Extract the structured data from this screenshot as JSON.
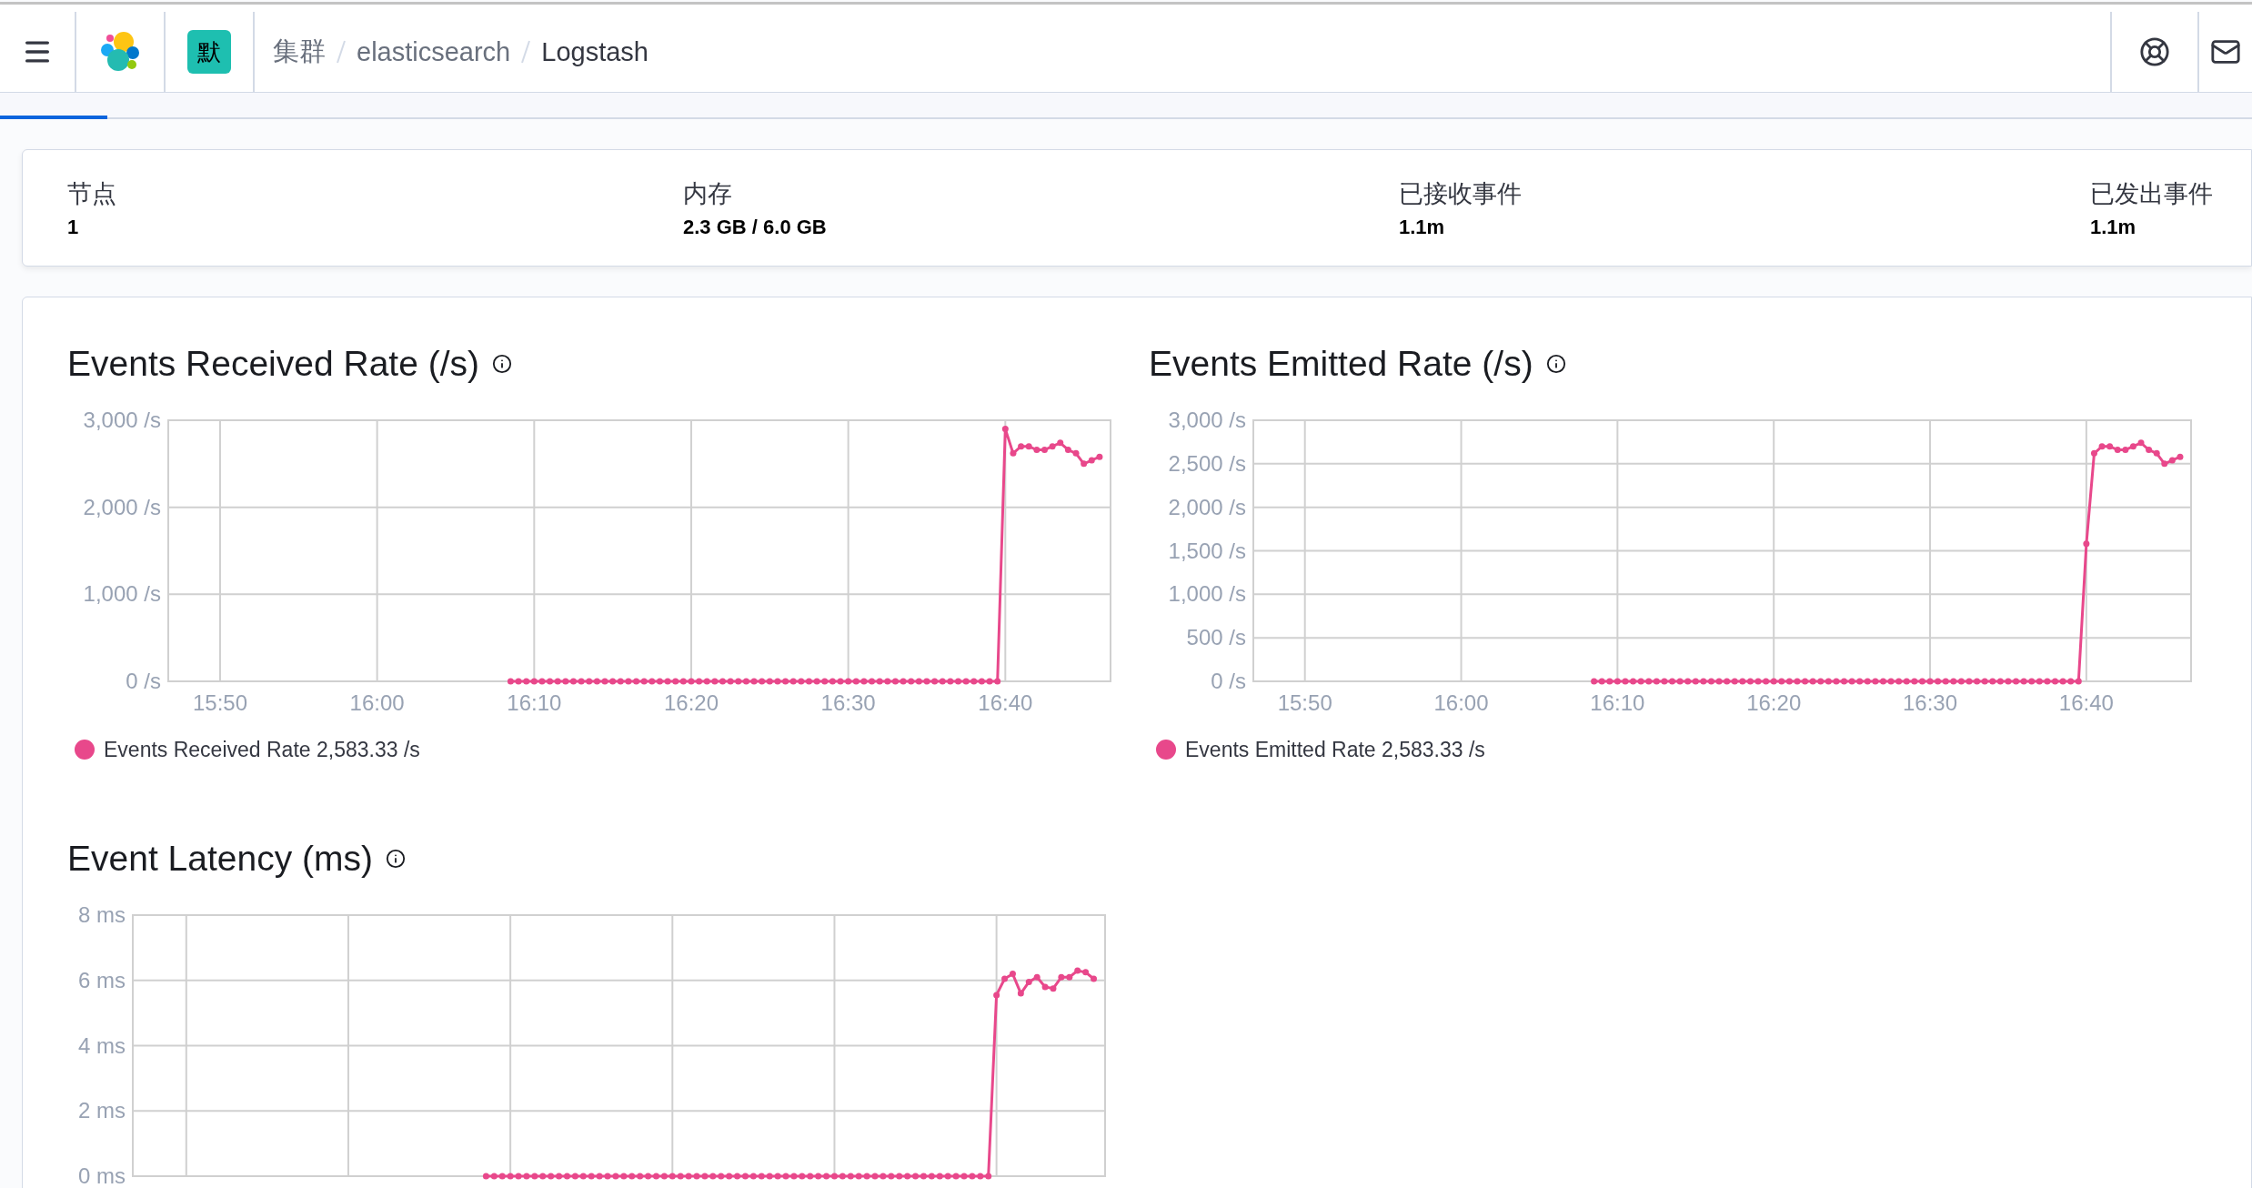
{
  "header": {
    "space_badge": "默",
    "breadcrumbs": [
      {
        "label": "集群",
        "current": false
      },
      {
        "label": "elasticsearch",
        "current": false
      },
      {
        "label": "Logstash",
        "current": true
      }
    ]
  },
  "stats": [
    {
      "label": "节点",
      "value": "1"
    },
    {
      "label": "内存",
      "value": "2.3 GB / 6.0 GB"
    },
    {
      "label": "已接收事件",
      "value": "1.1m"
    },
    {
      "label": "已发出事件",
      "value": "1.1m"
    }
  ],
  "charts": [
    {
      "legend_value": "2,583.33 /s",
      "chart_data": {
        "type": "line",
        "title": "Events Received Rate (/s)",
        "grid": true,
        "ylim": [
          0,
          3000
        ],
        "categories": [
          null,
          null,
          null,
          null,
          null,
          null,
          "15:50",
          null,
          null,
          null,
          null,
          null,
          null,
          null,
          null,
          null,
          null,
          null,
          null,
          null,
          null,
          null,
          null,
          null,
          null,
          null,
          "16:00",
          null,
          null,
          null,
          null,
          null,
          null,
          null,
          null,
          null,
          null,
          null,
          null,
          null,
          null,
          null,
          null,
          null,
          null,
          null,
          "16:10",
          null,
          null,
          null,
          null,
          null,
          null,
          null,
          null,
          null,
          null,
          null,
          null,
          null,
          null,
          null,
          null,
          null,
          null,
          null,
          "16:20",
          null,
          null,
          null,
          null,
          null,
          null,
          null,
          null,
          null,
          null,
          null,
          null,
          null,
          null,
          null,
          null,
          null,
          null,
          null,
          "16:30",
          null,
          null,
          null,
          null,
          null,
          null,
          null,
          null,
          null,
          null,
          null,
          null,
          null,
          null,
          null,
          null,
          null,
          null,
          null,
          "16:40",
          null,
          null,
          null,
          null,
          null,
          null,
          null,
          null,
          null,
          null,
          null,
          null
        ],
        "yticks": [
          {
            "value": 0,
            "label": "0 /s"
          },
          {
            "value": 1000,
            "label": "1,000 /s"
          },
          {
            "value": 2000,
            "label": "2,000 /s"
          },
          {
            "value": 3000,
            "label": "3,000 /s"
          }
        ],
        "series": [
          {
            "name": "Events Received Rate",
            "color": "#e8488b",
            "marker": "circle",
            "values": [
              null,
              null,
              null,
              null,
              null,
              null,
              null,
              null,
              null,
              null,
              null,
              null,
              null,
              null,
              null,
              null,
              null,
              null,
              null,
              null,
              null,
              null,
              null,
              null,
              null,
              null,
              null,
              null,
              null,
              null,
              null,
              null,
              null,
              null,
              null,
              null,
              null,
              null,
              null,
              null,
              null,
              null,
              null,
              0,
              0,
              0,
              0,
              0,
              0,
              0,
              0,
              0,
              0,
              0,
              0,
              0,
              0,
              0,
              0,
              0,
              0,
              0,
              0,
              0,
              0,
              0,
              0,
              0,
              0,
              0,
              0,
              0,
              0,
              0,
              0,
              0,
              0,
              0,
              0,
              0,
              0,
              0,
              0,
              0,
              0,
              0,
              0,
              0,
              0,
              0,
              0,
              0,
              0,
              0,
              0,
              0,
              0,
              0,
              0,
              0,
              0,
              0,
              0,
              0,
              0,
              0,
              2900,
              2620,
              2700,
              2700,
              2660,
              2660,
              2700,
              2740,
              2660,
              2620,
              2500,
              2540,
              2580
            ]
          }
        ]
      }
    },
    {
      "legend_value": "2,583.33 /s",
      "chart_data": {
        "type": "line",
        "title": "Events Emitted Rate (/s)",
        "grid": true,
        "ylim": [
          0,
          3000
        ],
        "categories": [
          null,
          null,
          null,
          null,
          null,
          null,
          "15:50",
          null,
          null,
          null,
          null,
          null,
          null,
          null,
          null,
          null,
          null,
          null,
          null,
          null,
          null,
          null,
          null,
          null,
          null,
          null,
          "16:00",
          null,
          null,
          null,
          null,
          null,
          null,
          null,
          null,
          null,
          null,
          null,
          null,
          null,
          null,
          null,
          null,
          null,
          null,
          null,
          "16:10",
          null,
          null,
          null,
          null,
          null,
          null,
          null,
          null,
          null,
          null,
          null,
          null,
          null,
          null,
          null,
          null,
          null,
          null,
          null,
          "16:20",
          null,
          null,
          null,
          null,
          null,
          null,
          null,
          null,
          null,
          null,
          null,
          null,
          null,
          null,
          null,
          null,
          null,
          null,
          null,
          "16:30",
          null,
          null,
          null,
          null,
          null,
          null,
          null,
          null,
          null,
          null,
          null,
          null,
          null,
          null,
          null,
          null,
          null,
          null,
          null,
          "16:40",
          null,
          null,
          null,
          null,
          null,
          null,
          null,
          null,
          null,
          null,
          null,
          null
        ],
        "yticks": [
          {
            "value": 0,
            "label": "0 /s"
          },
          {
            "value": 500,
            "label": "500 /s"
          },
          {
            "value": 1000,
            "label": "1,000 /s"
          },
          {
            "value": 1500,
            "label": "1,500 /s"
          },
          {
            "value": 2000,
            "label": "2,000 /s"
          },
          {
            "value": 2500,
            "label": "2,500 /s"
          },
          {
            "value": 3000,
            "label": "3,000 /s"
          }
        ],
        "series": [
          {
            "name": "Events Emitted Rate",
            "color": "#e8488b",
            "marker": "circle",
            "values": [
              null,
              null,
              null,
              null,
              null,
              null,
              null,
              null,
              null,
              null,
              null,
              null,
              null,
              null,
              null,
              null,
              null,
              null,
              null,
              null,
              null,
              null,
              null,
              null,
              null,
              null,
              null,
              null,
              null,
              null,
              null,
              null,
              null,
              null,
              null,
              null,
              null,
              null,
              null,
              null,
              null,
              null,
              null,
              0,
              0,
              0,
              0,
              0,
              0,
              0,
              0,
              0,
              0,
              0,
              0,
              0,
              0,
              0,
              0,
              0,
              0,
              0,
              0,
              0,
              0,
              0,
              0,
              0,
              0,
              0,
              0,
              0,
              0,
              0,
              0,
              0,
              0,
              0,
              0,
              0,
              0,
              0,
              0,
              0,
              0,
              0,
              0,
              0,
              0,
              0,
              0,
              0,
              0,
              0,
              0,
              0,
              0,
              0,
              0,
              0,
              0,
              0,
              0,
              0,
              0,
              0,
              1580,
              2620,
              2700,
              2700,
              2660,
              2660,
              2700,
              2740,
              2660,
              2620,
              2500,
              2540,
              2580
            ]
          }
        ]
      }
    },
    {
      "chart_data": {
        "type": "line",
        "title": "Event Latency (ms)",
        "grid": true,
        "ylim": [
          0,
          8
        ],
        "yticks": [
          {
            "value": 0,
            "label": "0 ms"
          },
          {
            "value": 2,
            "label": "2 ms"
          },
          {
            "value": 4,
            "label": "4 ms"
          },
          {
            "value": 6,
            "label": "6 ms"
          },
          {
            "value": 8,
            "label": "8 ms"
          }
        ],
        "series": [
          {
            "color": "#e8488b",
            "marker": "circle",
            "values": [
              0,
              0,
              0,
              0,
              0,
              0,
              0,
              0,
              0,
              0,
              0,
              0,
              0,
              0,
              0,
              0,
              0,
              0,
              0,
              0,
              0,
              0,
              0,
              0,
              0,
              0,
              0,
              0,
              0,
              0,
              0,
              0,
              0,
              0,
              0,
              0,
              0,
              0,
              0,
              0,
              0,
              0,
              0,
              0,
              0,
              0,
              0,
              0,
              0,
              0,
              0,
              0,
              0,
              0,
              0,
              0,
              0,
              0,
              0,
              0,
              0,
              0,
              0,
              5.55,
              6.05,
              6.2,
              5.6,
              5.95,
              6.1,
              5.8,
              5.75,
              6.1,
              6.1,
              6.3,
              6.25,
              6.05
            ]
          }
        ]
      }
    }
  ]
}
